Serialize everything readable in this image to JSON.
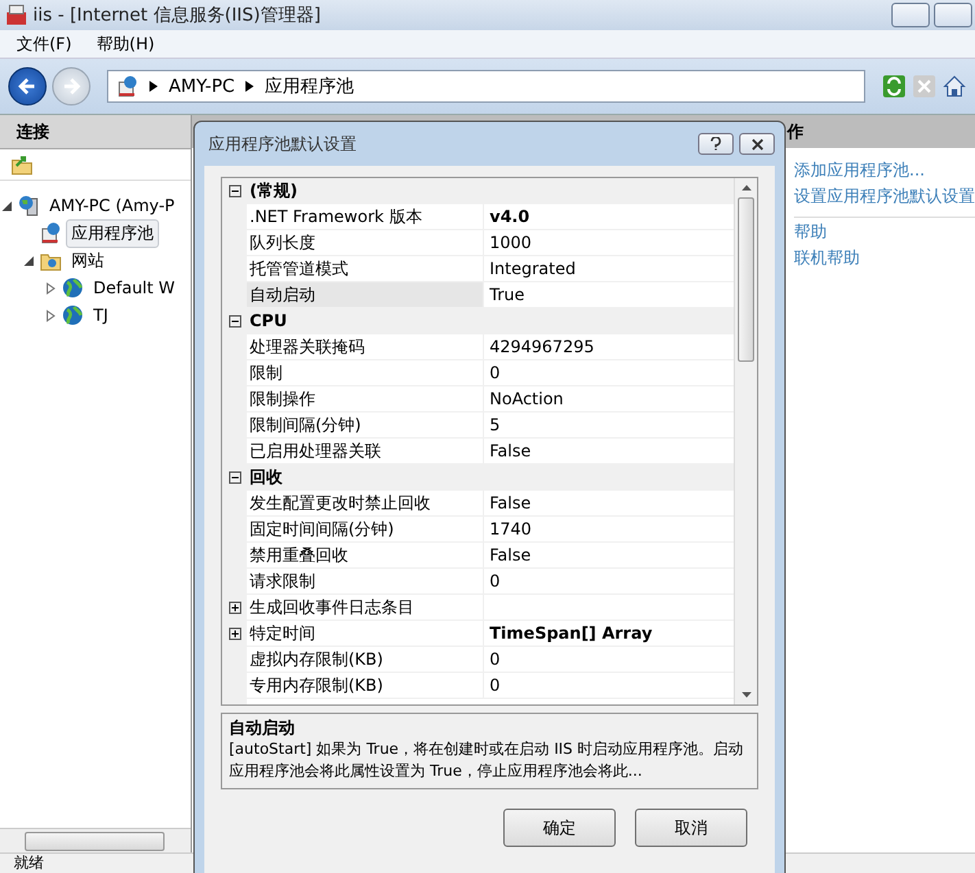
{
  "window": {
    "title": "iis - [Internet 信息服务(IIS)管理器]"
  },
  "menu": [
    "文件(F)",
    "帮助(H)"
  ],
  "address": {
    "crumbs": [
      "AMY-PC",
      "应用程序池"
    ]
  },
  "connections": {
    "title": "连接",
    "tree": [
      {
        "label": "AMY-PC (Amy-P",
        "expanded": true,
        "selected": false,
        "children": [
          {
            "label": "应用程序池",
            "selected": true
          },
          {
            "label": "网站",
            "expanded": true,
            "selected": false,
            "children": [
              {
                "label": "Default W",
                "expanded": false,
                "selected": false
              },
              {
                "label": "TJ",
                "expanded": false,
                "selected": false
              }
            ]
          }
        ]
      }
    ]
  },
  "actions": {
    "title": "作",
    "groups": [
      [
        "添加应用程序池...",
        "设置应用程序池默认设置"
      ],
      [
        "帮助",
        "联机帮助"
      ]
    ]
  },
  "status_bar": "就绪",
  "dialog": {
    "title": "应用程序池默认设置",
    "rows": [
      {
        "kind": "category",
        "name": "(常规)",
        "expanded": true
      },
      {
        "kind": "property",
        "name": ".NET Framework 版本",
        "value": "v4.0",
        "modified": true,
        "selected": false
      },
      {
        "kind": "property",
        "name": "队列长度",
        "value": "1000",
        "modified": false,
        "selected": false
      },
      {
        "kind": "property",
        "name": "托管管道模式",
        "value": "Integrated",
        "modified": false,
        "selected": false
      },
      {
        "kind": "property",
        "name": "自动启动",
        "value": "True",
        "modified": false,
        "selected": true
      },
      {
        "kind": "category",
        "name": "CPU",
        "expanded": true
      },
      {
        "kind": "property",
        "name": "处理器关联掩码",
        "value": "4294967295",
        "modified": false,
        "selected": false
      },
      {
        "kind": "property",
        "name": "限制",
        "value": "0",
        "modified": false,
        "selected": false
      },
      {
        "kind": "property",
        "name": "限制操作",
        "value": "NoAction",
        "modified": false,
        "selected": false
      },
      {
        "kind": "property",
        "name": "限制间隔(分钟)",
        "value": "5",
        "modified": false,
        "selected": false
      },
      {
        "kind": "property",
        "name": "已启用处理器关联",
        "value": "False",
        "modified": false,
        "selected": false
      },
      {
        "kind": "category",
        "name": "回收",
        "expanded": true
      },
      {
        "kind": "property",
        "name": "发生配置更改时禁止回收",
        "value": "False",
        "modified": false,
        "selected": false
      },
      {
        "kind": "property",
        "name": "固定时间间隔(分钟)",
        "value": "1740",
        "modified": false,
        "selected": false
      },
      {
        "kind": "property",
        "name": "禁用重叠回收",
        "value": "False",
        "modified": false,
        "selected": false
      },
      {
        "kind": "property",
        "name": "请求限制",
        "value": "0",
        "modified": false,
        "selected": false
      },
      {
        "kind": "group",
        "name": "生成回收事件日志条目",
        "expanded": false,
        "selected": false
      },
      {
        "kind": "group",
        "name": "特定时间",
        "value": "TimeSpan[] Array",
        "expanded": false,
        "modified": true,
        "selected": false
      },
      {
        "kind": "property",
        "name": "虚拟内存限制(KB)",
        "value": "0",
        "modified": false,
        "selected": false
      },
      {
        "kind": "property",
        "name": "专用内存限制(KB)",
        "value": "0",
        "modified": false,
        "selected": false
      }
    ],
    "description": {
      "title": "自动启动",
      "text": "[autoStart] 如果为 True，将在创建时或在启动 IIS 时启动应用程序池。启动应用程序池会将此属性设置为 True，停止应用程序池会将此..."
    },
    "buttons": [
      "确定",
      "取消"
    ]
  }
}
